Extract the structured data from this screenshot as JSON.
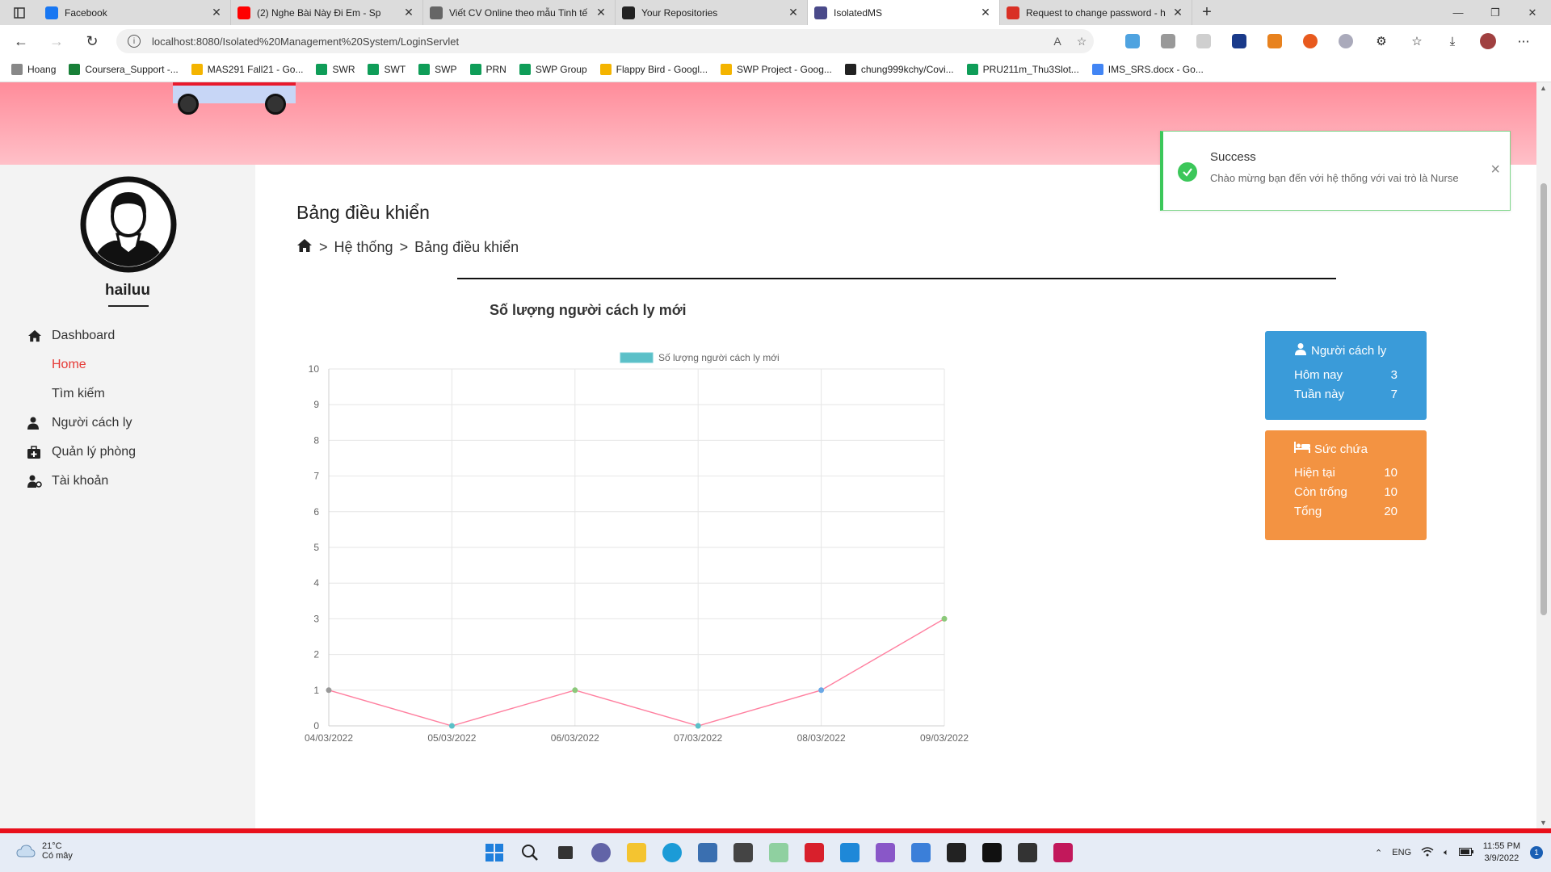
{
  "browser": {
    "tabs": [
      {
        "title": "Facebook",
        "icon": "facebook-icon",
        "color": "#1877f2",
        "active": false
      },
      {
        "title": "(2) Nghe Bài Này Đi Em - Sp",
        "icon": "youtube-icon",
        "color": "#ff0000",
        "active": false
      },
      {
        "title": "Viết CV Online theo mẫu Tinh tế",
        "icon": "document-icon",
        "color": "#666666",
        "active": false
      },
      {
        "title": "Your Repositories",
        "icon": "github-icon",
        "color": "#222222",
        "active": false
      },
      {
        "title": "IsolatedMS",
        "icon": "c-icon",
        "color": "#4a4a8a",
        "active": true
      },
      {
        "title": "Request to change password - h",
        "icon": "gmail-icon",
        "color": "#d93025",
        "active": false
      }
    ],
    "url": "localhost:8080/Isolated%20Management%20System/LoginServlet",
    "bookmarks": [
      {
        "label": "Hoang",
        "color": "#888888"
      },
      {
        "label": "Coursera_Support -...",
        "color": "#188038"
      },
      {
        "label": "MAS291 Fall21 - Go...",
        "color": "#f4b400"
      },
      {
        "label": "SWR",
        "color": "#0f9d58"
      },
      {
        "label": "SWT",
        "color": "#0f9d58"
      },
      {
        "label": "SWP",
        "color": "#0f9d58"
      },
      {
        "label": "PRN",
        "color": "#0f9d58"
      },
      {
        "label": "SWP Group",
        "color": "#0f9d58"
      },
      {
        "label": "Flappy Bird - Googl...",
        "color": "#f4b400"
      },
      {
        "label": "SWP Project - Goog...",
        "color": "#f4b400"
      },
      {
        "label": "chung999kchy/Covi...",
        "color": "#222222"
      },
      {
        "label": "PRU211m_Thu3Slot...",
        "color": "#0f9d58"
      },
      {
        "label": "IMS_SRS.docx - Go...",
        "color": "#4285f4"
      }
    ]
  },
  "user": {
    "name": "hailuu"
  },
  "sidebar": {
    "items": [
      {
        "label": "Dashboard",
        "icon": "home-icon",
        "sub": false,
        "active": false
      },
      {
        "label": "Home",
        "icon": "",
        "sub": true,
        "active": true
      },
      {
        "label": "Tìm kiếm",
        "icon": "",
        "sub": true,
        "active": false
      },
      {
        "label": "Người cách ly",
        "icon": "user-icon",
        "sub": false,
        "active": false
      },
      {
        "label": "Quản lý phòng",
        "icon": "medkit-icon",
        "sub": false,
        "active": false
      },
      {
        "label": "Tài khoản",
        "icon": "user-gear-icon",
        "sub": false,
        "active": false
      }
    ]
  },
  "main": {
    "title": "Bảng điều khiển",
    "breadcrumb": [
      ">",
      "Hệ thống",
      ">",
      "Bảng điều khiển"
    ]
  },
  "chart_data": {
    "type": "line",
    "title": "Số lượng người cách ly mới",
    "categories": [
      "04/03/2022",
      "05/03/2022",
      "06/03/2022",
      "07/03/2022",
      "08/03/2022",
      "09/03/2022"
    ],
    "series": [
      {
        "name": "Số lượng người cách ly mới",
        "values": [
          1,
          0,
          1,
          0,
          1,
          3
        ]
      }
    ],
    "ylim": [
      0,
      10
    ],
    "yticks": [
      0,
      1,
      2,
      3,
      4,
      5,
      6,
      7,
      8,
      9,
      10
    ],
    "grid": true,
    "legend": "top",
    "line_color": "#ff7f9f",
    "legend_color": "#5bc0c8",
    "point_colors": [
      "#999999",
      "#5bc0c8",
      "#8bc97a",
      "#5bc0c8",
      "#6aa8e6",
      "#8bc97a"
    ]
  },
  "cards": {
    "quarantine": {
      "title": "Người cách ly",
      "color": "#3a9bd9",
      "rows": [
        {
          "label": "Hôm nay",
          "value": "3"
        },
        {
          "label": "Tuần này",
          "value": "7"
        }
      ]
    },
    "capacity": {
      "title": "Sức chứa",
      "color": "#f39342",
      "rows": [
        {
          "label": "Hiện tại",
          "value": "10"
        },
        {
          "label": "Còn trống",
          "value": "10"
        },
        {
          "label": "Tổng",
          "value": "20"
        }
      ]
    }
  },
  "toast": {
    "title": "Success",
    "message": "Chào mừng bạn đến với hệ thống với vai trò là Nurse"
  },
  "taskbar": {
    "weather_temp": "21°C",
    "weather_desc": "Có mây",
    "lang": "ENG",
    "time": "11:55 PM",
    "date": "3/9/2022",
    "notif_count": "1"
  }
}
